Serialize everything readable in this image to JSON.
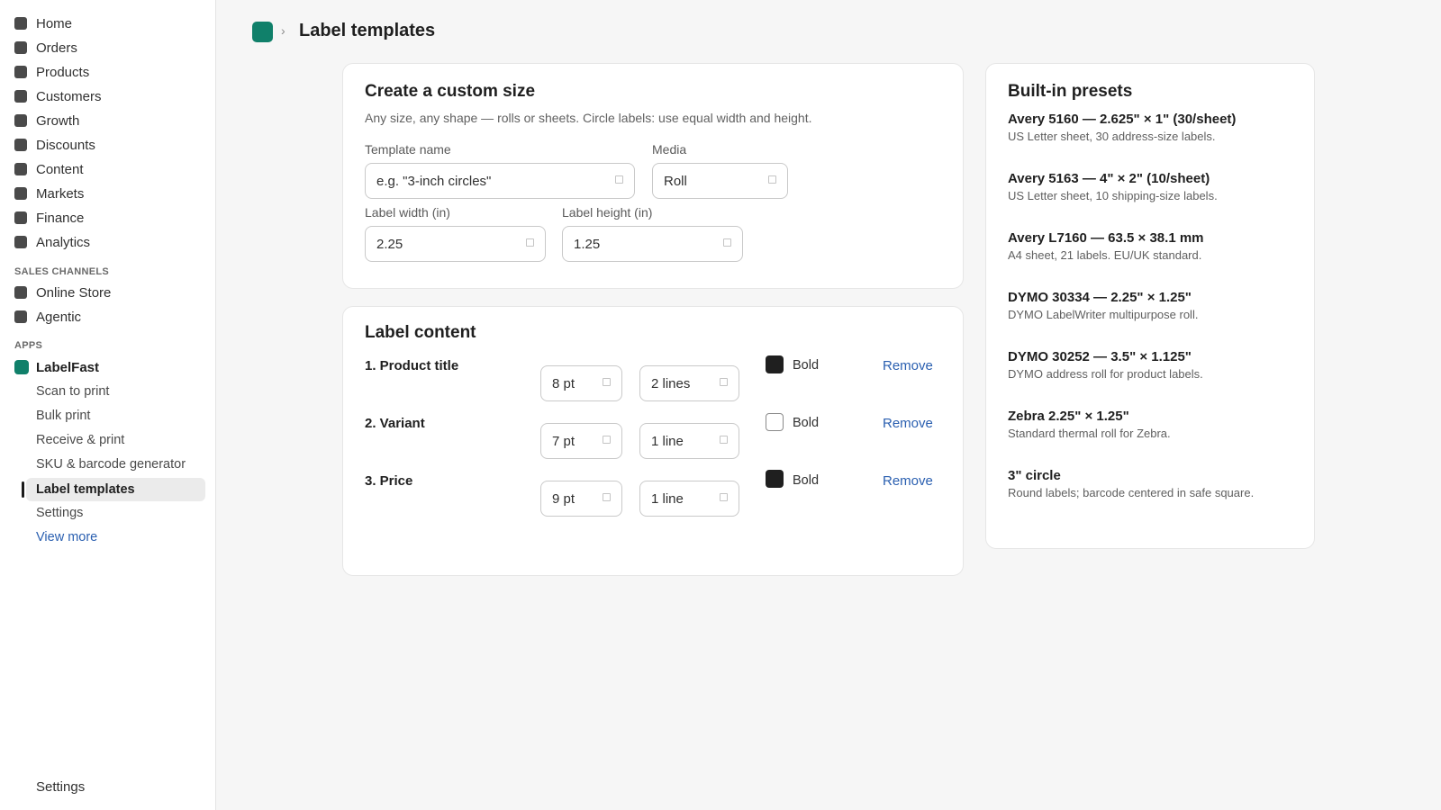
{
  "sidebar": {
    "nav": [
      {
        "label": "Home",
        "icon": "home-icon"
      },
      {
        "label": "Orders",
        "icon": "orders-icon"
      },
      {
        "label": "Products",
        "icon": "products-icon"
      },
      {
        "label": "Customers",
        "icon": "customers-icon"
      },
      {
        "label": "Growth",
        "icon": "growth-icon"
      },
      {
        "label": "Discounts",
        "icon": "discounts-icon"
      },
      {
        "label": "Content",
        "icon": "content-icon"
      },
      {
        "label": "Markets",
        "icon": "markets-icon"
      },
      {
        "label": "Finance",
        "icon": "finance-icon"
      },
      {
        "label": "Analytics",
        "icon": "analytics-icon"
      }
    ],
    "sales_channels_title": "SALES CHANNELS",
    "sales_channels": [
      {
        "label": "Online Store"
      },
      {
        "label": "Agentic"
      }
    ],
    "apps_title": "APPS",
    "app_name": "LabelFast",
    "app_items": [
      {
        "label": "Scan to print"
      },
      {
        "label": "Bulk print"
      },
      {
        "label": "Receive & print"
      },
      {
        "label": "SKU & barcode generator"
      },
      {
        "label": "Label templates"
      },
      {
        "label": "Settings"
      }
    ],
    "view_more": "View more",
    "bottom_settings": "Settings",
    "brand_color": "#10806a"
  },
  "header": {
    "separator": "›",
    "title": "Label templates"
  },
  "custom_size": {
    "title": "Create a custom size",
    "description": "Any size, any shape — rolls or sheets. Circle labels: use equal width and height.",
    "template_name_label": "Template name",
    "template_name_placeholder": "e.g. \"3-inch circles\"",
    "media_label": "Media",
    "media_value": "Roll",
    "width_label": "Label width (in)",
    "width_value": "2.25",
    "height_label": "Label height (in)",
    "height_value": "1.25"
  },
  "label_content": {
    "title": "Label content",
    "bold_label": "Bold",
    "remove_label": "Remove",
    "rows": [
      {
        "title": "1. Product title",
        "size": "8 pt",
        "lines": "2 lines",
        "bold": true
      },
      {
        "title": "2. Variant",
        "size": "7 pt",
        "lines": "1 line",
        "bold": false
      },
      {
        "title": "3. Price",
        "size": "9 pt",
        "lines": "1 line",
        "bold": true
      }
    ]
  },
  "presets": {
    "title": "Built-in presets",
    "items": [
      {
        "name": "Avery 5160 — 2.625\" × 1\" (30/sheet)",
        "desc": "US Letter sheet, 30 address-size labels."
      },
      {
        "name": "Avery 5163 — 4\" × 2\" (10/sheet)",
        "desc": "US Letter sheet, 10 shipping-size labels."
      },
      {
        "name": "Avery L7160 — 63.5 × 38.1 mm",
        "desc": "A4 sheet, 21 labels. EU/UK standard."
      },
      {
        "name": "DYMO 30334 — 2.25\" × 1.25\"",
        "desc": "DYMO LabelWriter multipurpose roll."
      },
      {
        "name": "DYMO 30252 — 3.5\" × 1.125\"",
        "desc": "DYMO address roll for product labels."
      },
      {
        "name": "Zebra 2.25\" × 1.25\"",
        "desc": "Standard thermal roll for Zebra."
      },
      {
        "name": "3\" circle",
        "desc": "Round labels; barcode centered in safe square."
      }
    ]
  },
  "colors": {
    "accent": "#10806a",
    "link": "#2a5fb0"
  }
}
